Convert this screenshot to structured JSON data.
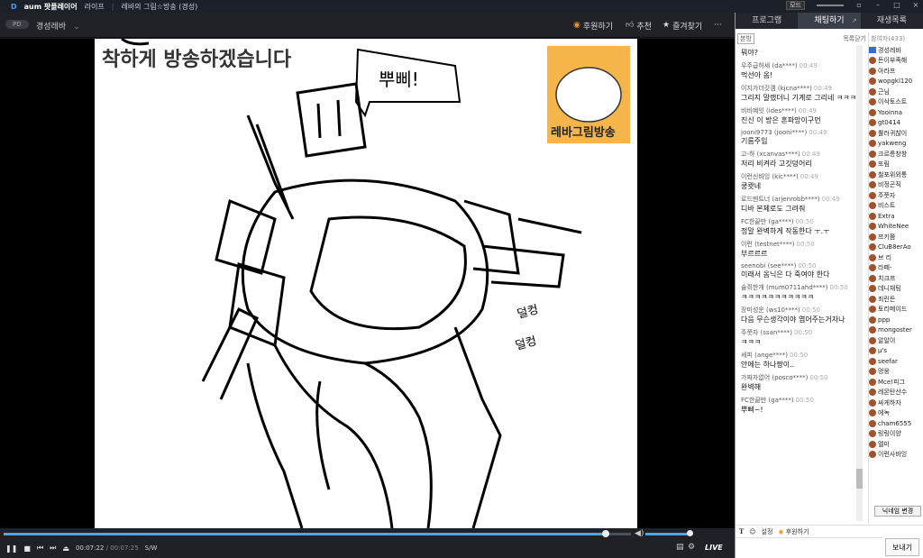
{
  "titlebar": {
    "logo_d": "D",
    "logo_rest": "aum 팟플레이어",
    "menu_live": "라이프",
    "sep": "|",
    "window_title": "레바의 그림☆방송 (경성)",
    "mode_label": "모드",
    "btn_pin": "▫",
    "btn_min": "–",
    "btn_max": "□",
    "btn_close": "×"
  },
  "topbar": {
    "pd_badge": "PD",
    "channel_name": "경성레바",
    "channel_chevron": "⌄",
    "donate_label": "후원하기",
    "recommend_label": "추천",
    "favorite_label": "즐겨찾기",
    "more_label": "···"
  },
  "video": {
    "caption_text": "착하게 방송하겠습니다",
    "speech_text": "뿌삐!",
    "effect_text_1": "덜컹",
    "effect_text_2": "덜컹",
    "logo_text": "레바그림방송",
    "accent_color": "#f5b54a"
  },
  "controls": {
    "current_time": "00:07:22",
    "sep": "/",
    "total_time": "00:07:25",
    "sw_label": "S/W",
    "live_label": "LIVE",
    "progress_fraction": 0.96,
    "volume_fraction": 0.95
  },
  "sidebar": {
    "tabs": [
      "프로그램",
      "채팅하기",
      "재생목록"
    ],
    "active_tab": 1,
    "popout_icon": "↗",
    "notice_btn": "본방",
    "close_list": "목록닫기",
    "participants_label": "참여자(433)",
    "messages": [
      {
        "user": "",
        "time": "",
        "text": "뭐야?"
      },
      {
        "user": "우주급허세 (da****)",
        "time": "00:49",
        "text": "먹선아 옴!"
      },
      {
        "user": "이지가더갓겜 (kjcna****)",
        "time": "00:49",
        "text": "그리지 말랬더니 기계로 그리네 ㅋㅋㅋ"
      },
      {
        "user": "비비예잇 (ides****)",
        "time": "00:49",
        "text": "진신 이 방은 혼파망이구먼"
      },
      {
        "user": "jooni9773 (jooni****)",
        "time": "00:49",
        "text": "기름주입"
      },
      {
        "user": "고-하 (xcanvas****)",
        "time": "00:49",
        "text": "저리 비켜라 고깃덩어리"
      },
      {
        "user": "이런신바잉 (kic****)",
        "time": "00:49",
        "text": "쿵쾃네"
      },
      {
        "user": "로드맨트너 (arjenrobb****)",
        "time": "00:49",
        "text": "디바 본체로도 그려줘"
      },
      {
        "user": "FC한끝만 (ga****)",
        "time": "00:50",
        "text": "정말 완벽하게 작동한다 ㅜ.ㅜ"
      },
      {
        "user": "이런 (testnet****)",
        "time": "00:50",
        "text": "부르르르"
      },
      {
        "user": "seenobi (see****)",
        "time": "00:50",
        "text": "이래서 옴닉은 다 죽여야 한다"
      },
      {
        "user": "술쥐한개 (mum0711ahd****)",
        "time": "00:50",
        "text": "ㅋㅋㅋㅋㅋㅋㅋㅋㅋㅋㅋ"
      },
      {
        "user": "장미성운 (ws10****)",
        "time": "00:50",
        "text": "다음 무슨생각이야 엽어주는거자나"
      },
      {
        "user": "주쭛자 (ssan****)",
        "time": "00:50",
        "text": "ㅋㅋㅋ"
      },
      {
        "user": "세피 (ange****)",
        "time": "00:50",
        "text": "안에는 하나짱이.."
      },
      {
        "user": "가짜자없어 (posco****)",
        "time": "00:50",
        "text": "완벽해"
      },
      {
        "user": "FC한끝만 (ga****)",
        "time": "00:50",
        "text": "뿌삐~!"
      }
    ],
    "participants": [
      "경성레바",
      "돈이부족해",
      "아라프",
      "wopgkl120",
      "근님",
      "이삭토스트",
      "Yooinna",
      "gt0414",
      "뿔러귀찮이",
      "yakweng",
      "크르릉창창",
      "또림",
      "철포위외통",
      "비정곤직",
      "주쭛자",
      "비스트",
      "Extra",
      "WhiteNee",
      "쯔키쯤",
      "CluB8erAo",
      "브 리",
      "라떼-",
      "치크프",
      "데니채팅",
      "죄린든",
      "토리메이드",
      "ppp",
      "mongoster",
      "알알이",
      "μ's",
      "seefar",
      "멍웅",
      "Mce!피그",
      "레몬탄산수",
      "싸게하자",
      "에녹",
      "cham6555",
      "링링이양",
      "멜미",
      "이런사바잉"
    ],
    "nick_change": "닉네임 변경",
    "input_bar": {
      "text_icon": "T",
      "emoji_icon": "☺",
      "settings": "설정",
      "donate": "후원하기"
    },
    "send_label": "보내기"
  }
}
